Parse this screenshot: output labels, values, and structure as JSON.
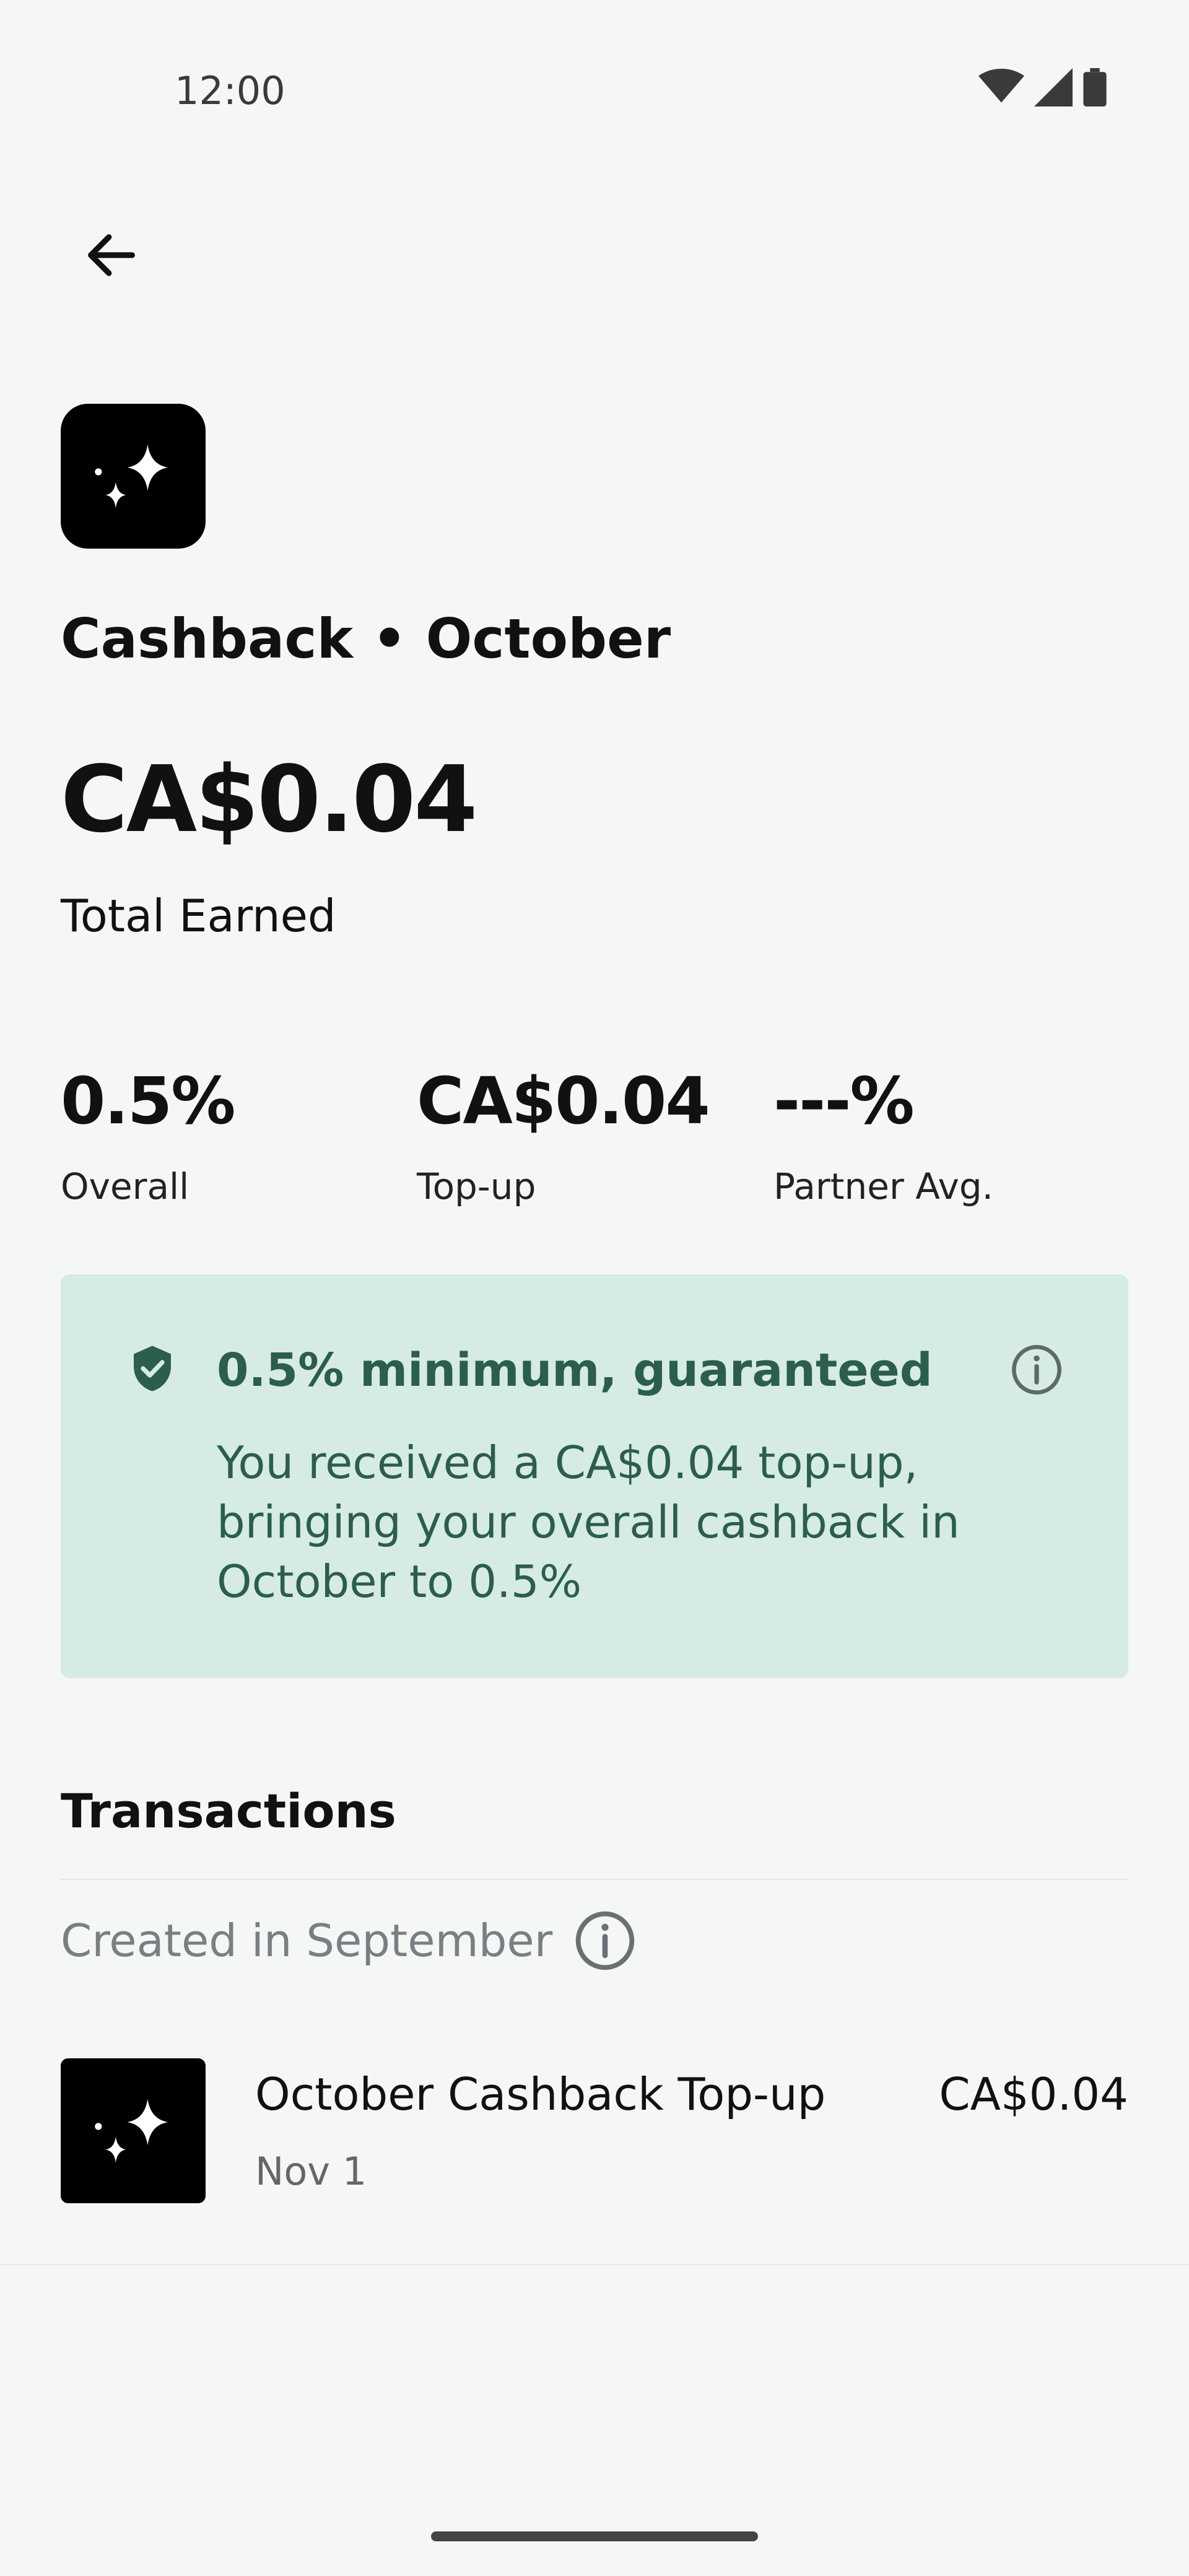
{
  "status_bar": {
    "time": "12:00"
  },
  "header": {
    "title": "Cashback • October"
  },
  "summary": {
    "amount": "CA$0.04",
    "label": "Total Earned"
  },
  "stats": [
    {
      "value": "0.5%",
      "label": "Overall"
    },
    {
      "value": "CA$0.04",
      "label": "Top-up"
    },
    {
      "value": "---%",
      "label": "Partner Avg."
    }
  ],
  "banner": {
    "title": "0.5% minimum, guaranteed",
    "body": "You received a CA$0.04 top-up, bringing your overall cashback in October to 0.5%"
  },
  "transactions": {
    "title": "Transactions",
    "group_label": "Created in September",
    "items": [
      {
        "title": "October Cashback Top-up",
        "date": "Nov 1",
        "amount": "CA$0.04"
      }
    ]
  },
  "icons": {
    "back": "arrow-left-icon",
    "app": "sparkle-icon",
    "shield": "shield-check-icon",
    "info": "info-icon",
    "tx": "sparkle-icon"
  },
  "colors": {
    "background": "#f5f7f6",
    "banner_bg": "#d6ebe5",
    "banner_text": "#2b5e4b"
  }
}
